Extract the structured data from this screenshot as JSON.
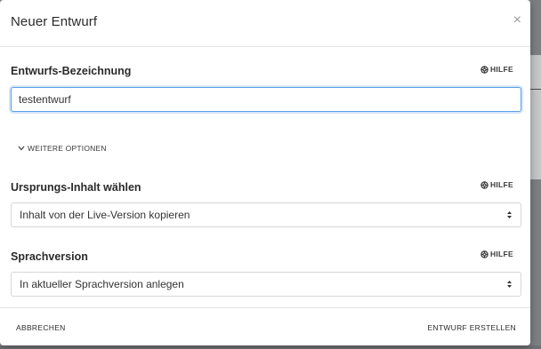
{
  "dialog": {
    "title": "Neuer Entwurf",
    "close_label": "×"
  },
  "fields": {
    "name": {
      "label": "Entwurfs-Bezeichnung",
      "help": "HILFE",
      "value": "testentwurf"
    },
    "more_options": "WEITERE OPTIONEN",
    "origin": {
      "label": "Ursprungs-Inhalt wählen",
      "help": "HILFE",
      "selected": "Inhalt von der Live-Version kopieren"
    },
    "language": {
      "label": "Sprachversion",
      "help": "HILFE",
      "selected": "In aktueller Sprachversion anlegen"
    }
  },
  "footer": {
    "cancel": "ABBRECHEN",
    "create": "ENTWURF ERSTELLEN"
  },
  "icons": {
    "help": "help-circle-icon",
    "expand": "chevron-down-icon",
    "select": "sort-arrows-icon",
    "close": "close-icon"
  },
  "colors": {
    "focus_border": "#5aa0e6",
    "backdrop": "#8a8c8f"
  }
}
